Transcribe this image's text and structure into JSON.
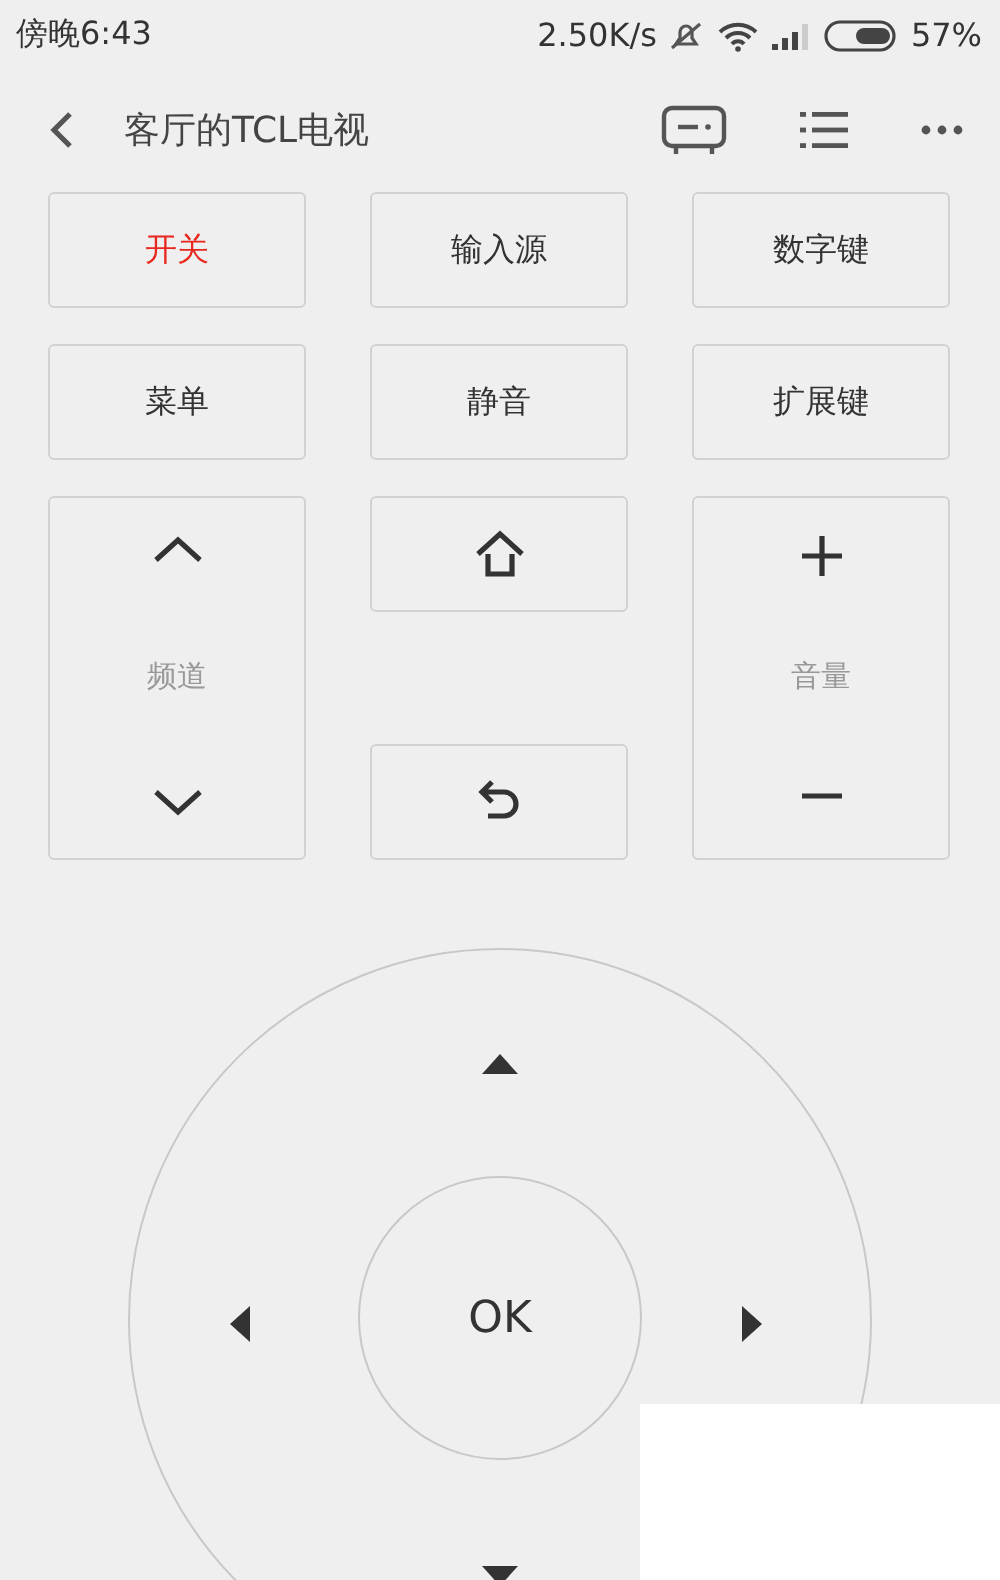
{
  "status_bar": {
    "time": "傍晚6:43",
    "speed": "2.50K/s",
    "battery": "57%"
  },
  "header": {
    "title": "客厅的TCL电视"
  },
  "buttons": [
    {
      "label": "开关",
      "kind": "power"
    },
    {
      "label": "输入源",
      "kind": "normal"
    },
    {
      "label": "数字键",
      "kind": "normal"
    },
    {
      "label": "菜单",
      "kind": "normal"
    },
    {
      "label": "静音",
      "kind": "normal"
    },
    {
      "label": "扩展键",
      "kind": "normal"
    }
  ],
  "channel": {
    "label": "频道"
  },
  "volume": {
    "label": "音量"
  },
  "dpad": {
    "ok": "OK"
  }
}
